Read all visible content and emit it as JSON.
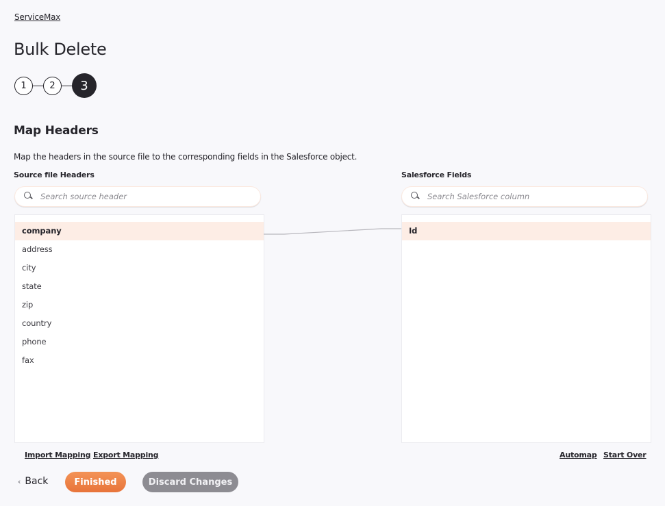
{
  "breadcrumb": "ServiceMax",
  "page_title": "Bulk Delete",
  "stepper": {
    "steps": [
      "1",
      "2",
      "3"
    ],
    "active_step": 3
  },
  "section": {
    "title": "Map Headers",
    "description": "Map the headers in the source file to the corresponding fields in the Salesforce object."
  },
  "source": {
    "label": "Source file Headers",
    "search_placeholder": "Search source header",
    "search_value": "",
    "items": [
      "company",
      "address",
      "city",
      "state",
      "zip",
      "country",
      "phone",
      "fax"
    ],
    "selected": "company"
  },
  "target": {
    "label": "Salesforce Fields",
    "search_placeholder": "Search Salesforce column",
    "search_value": "",
    "items": [
      "Id"
    ],
    "selected": "Id"
  },
  "mapping": [
    {
      "source": "company",
      "target": "Id"
    }
  ],
  "links": {
    "import_mapping": "Import Mapping",
    "export_mapping": "Export Mapping",
    "automap": "Automap",
    "start_over": "Start Over"
  },
  "footer": {
    "back_label": "Back",
    "back_icon": "chevron-left-icon",
    "finished_label": "Finished",
    "discard_label": "Discard Changes"
  },
  "colors": {
    "primary": "#e8743a",
    "selected_row": "#fdede5",
    "dark": "#26252b",
    "secondary_button": "#8d8c92"
  }
}
